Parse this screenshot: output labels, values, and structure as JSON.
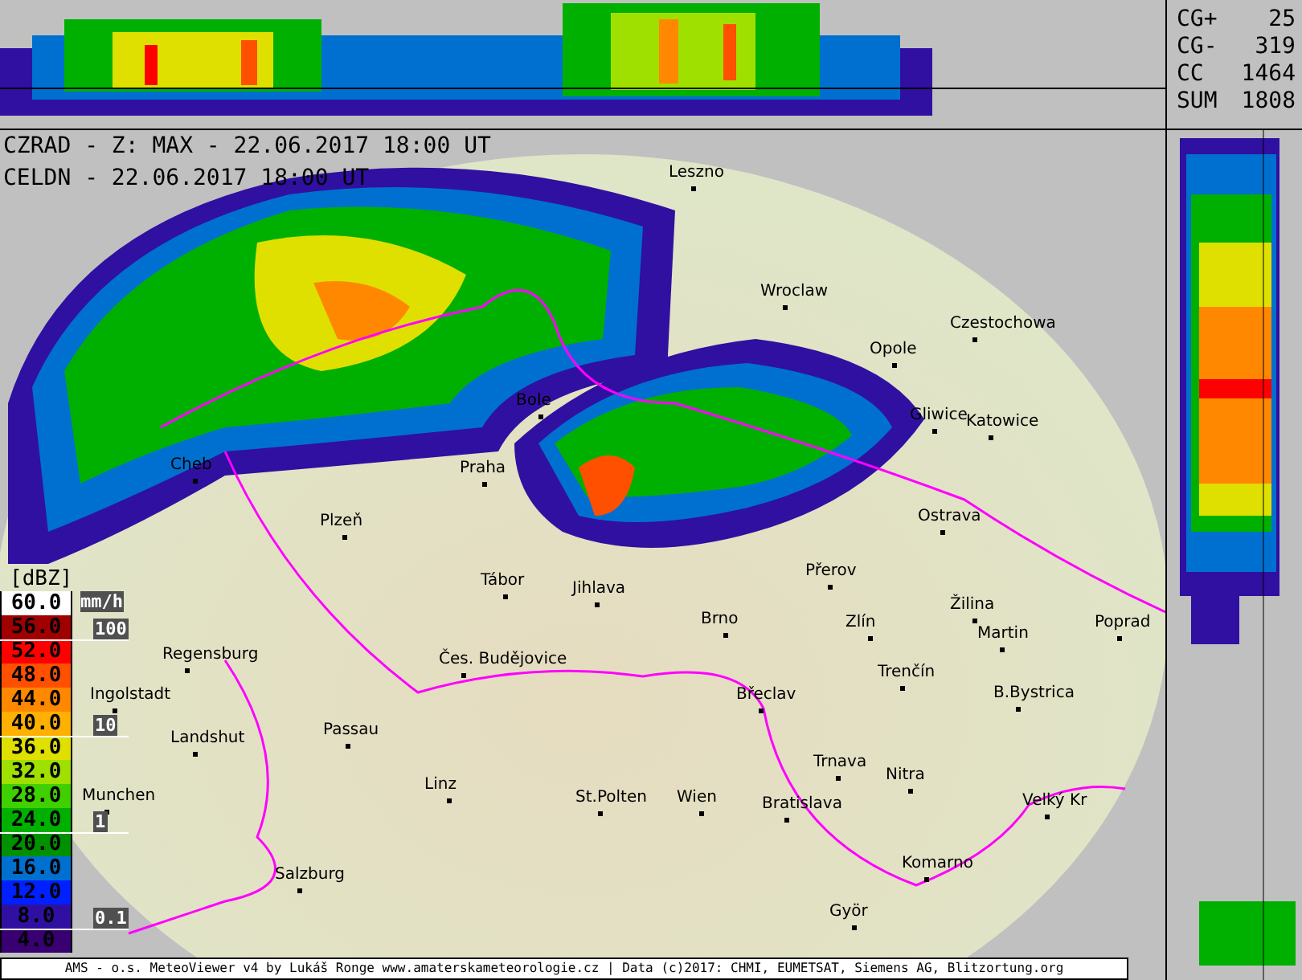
{
  "header": {
    "lines": [
      "CZRAD - Z: MAX - 22.06.2017 18:00 UT",
      "CELDN - 22.06.2017 18:00 UT"
    ]
  },
  "lightning_stats": [
    {
      "label": "CG+",
      "value": "25"
    },
    {
      "label": "CG-",
      "value": "319"
    },
    {
      "label": "CC",
      "value": "1464"
    },
    {
      "label": "SUM",
      "value": "1808"
    }
  ],
  "map": {
    "cities": [
      {
        "label": "Leszno"
      },
      {
        "label": "Wroclaw"
      },
      {
        "label": "Opole"
      },
      {
        "label": "Czestochowa"
      },
      {
        "label": "Gliwice"
      },
      {
        "label": "Katowice"
      },
      {
        "label": "Bole"
      },
      {
        "label": "Praha"
      },
      {
        "label": "Cheb"
      },
      {
        "label": "Plzeň"
      },
      {
        "label": "Tábor"
      },
      {
        "label": "Jihlava"
      },
      {
        "label": "Brno"
      },
      {
        "label": "Přerov"
      },
      {
        "label": "Ostrava"
      },
      {
        "label": "Žilina"
      },
      {
        "label": "Martin"
      },
      {
        "label": "Zlín"
      },
      {
        "label": "Poprad"
      },
      {
        "label": "Regensburg"
      },
      {
        "label": "Ingolstadt"
      },
      {
        "label": "Landshut"
      },
      {
        "label": "Passau"
      },
      {
        "label": "Čes. Budějovice"
      },
      {
        "label": "Břeclav"
      },
      {
        "label": "Trenčín"
      },
      {
        "label": "B.Bystrica"
      },
      {
        "label": "Trnava"
      },
      {
        "label": "Nitra"
      },
      {
        "label": "Munchen"
      },
      {
        "label": "Linz"
      },
      {
        "label": "St.Polten"
      },
      {
        "label": "Wien"
      },
      {
        "label": "Bratislava"
      },
      {
        "label": "Velký Kr"
      },
      {
        "label": "Salzburg"
      },
      {
        "label": "Komarno"
      },
      {
        "label": "Györ"
      }
    ]
  },
  "legend": {
    "unit": "[dBZ]",
    "rate_unit": "mm/h",
    "steps": [
      {
        "value": "60.0",
        "color": "#ffffff"
      },
      {
        "value": "56.0",
        "color": "#a00000"
      },
      {
        "value": "52.0",
        "color": "#ff0000"
      },
      {
        "value": "48.0",
        "color": "#ff5000"
      },
      {
        "value": "44.0",
        "color": "#ff8800"
      },
      {
        "value": "40.0",
        "color": "#ffb000"
      },
      {
        "value": "36.0",
        "color": "#e0e000"
      },
      {
        "value": "32.0",
        "color": "#a0e000"
      },
      {
        "value": "28.0",
        "color": "#40d000"
      },
      {
        "value": "24.0",
        "color": "#00b000"
      },
      {
        "value": "20.0",
        "color": "#009000"
      },
      {
        "value": "16.0",
        "color": "#0070d0"
      },
      {
        "value": "12.0",
        "color": "#0020ff"
      },
      {
        "value": "8.0",
        "color": "#3010a0"
      },
      {
        "value": "4.0",
        "color": "#380070"
      }
    ],
    "rates": [
      "100",
      "10",
      "1",
      "0.1"
    ]
  },
  "status_bar": {
    "text": "AMS - o.s. MeteoViewer v4 by Lukáš Ronge www.amaterskameteorologie.cz | Data (c)2017: CHMI, EUMETSAT, Siemens AG, Blitzortung.org"
  }
}
